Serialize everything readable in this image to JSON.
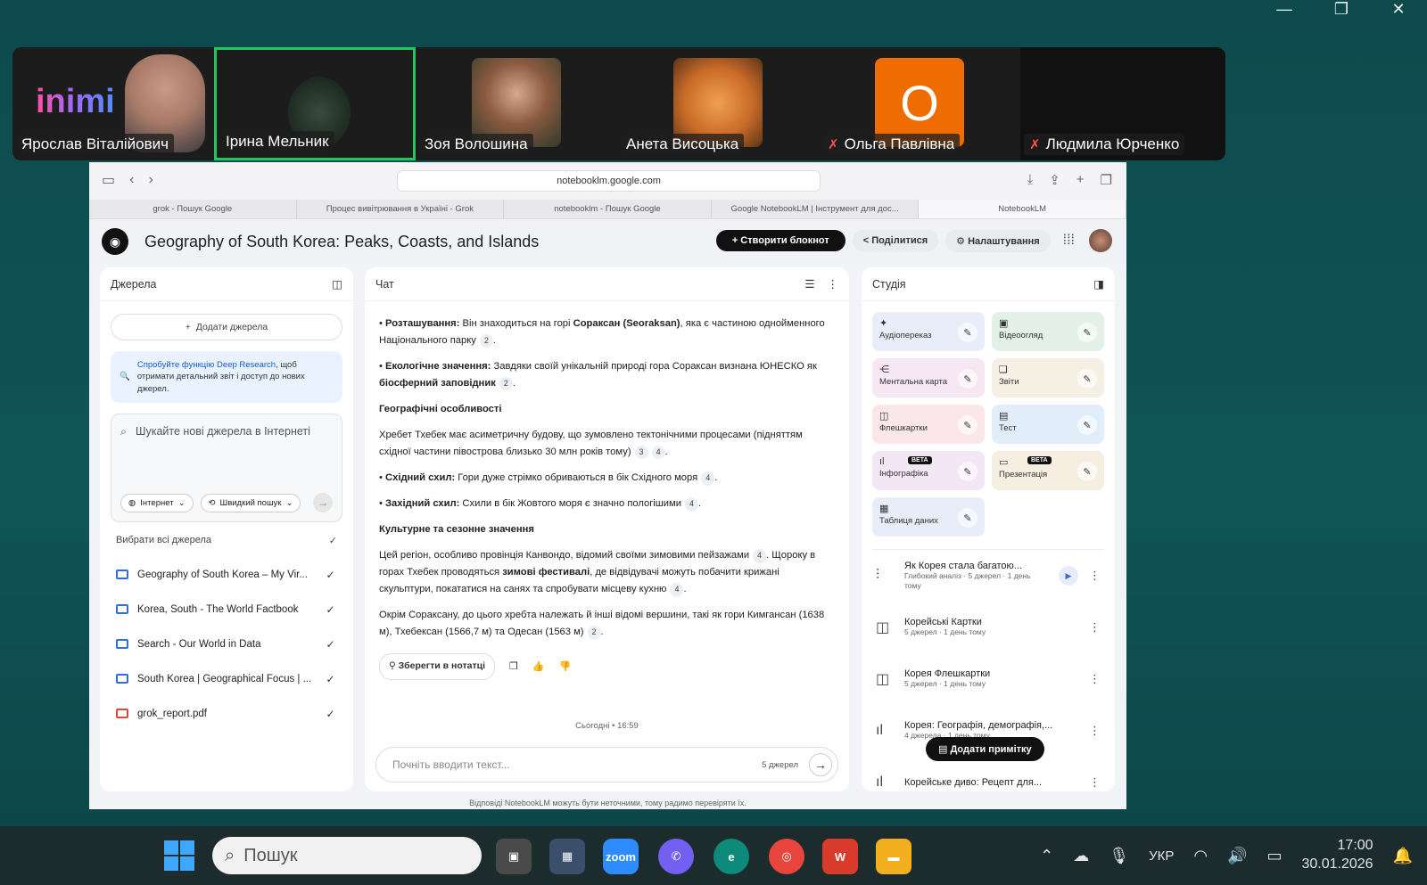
{
  "window": {
    "min": "—",
    "restore": "❐",
    "close": "✕"
  },
  "participants": [
    {
      "name": "Ярослав Віталійович",
      "muted": false
    },
    {
      "name": "Ірина Мельник",
      "muted": false
    },
    {
      "name": "Зоя Волошина",
      "muted": false
    },
    {
      "name": "Анета Висоцька",
      "muted": false
    },
    {
      "name": "Ольга Павлівна",
      "muted": true,
      "initial": "О"
    },
    {
      "name": "Людмила Юрченко",
      "muted": true
    }
  ],
  "browser": {
    "url": "notebooklm.google.com",
    "tabs": [
      "grok - Пошук Google",
      "Процес вивітрювання в Україні - Grok",
      "notebooklm - Пошук Google",
      "Google NotebookLM | Інструмент для дос...",
      "NotebookLM"
    ]
  },
  "notebook": {
    "title": "Geography of South Korea: Peaks, Coasts, and Islands",
    "create": "Створити блокнот",
    "share": "Поділитися",
    "settings": "Налаштування"
  },
  "sources": {
    "title": "Джерела",
    "add": "Додати джерела",
    "deep_link": "Спробуйте функцію Deep Research",
    "deep_rest": ", щоб отримати детальний звіт і доступ до нових джерел.",
    "search_placeholder": "Шукайте нові джерела в Інтернеті",
    "chip_web": "Інтернет",
    "chip_fast": "Швидкий пошук",
    "select_all": "Вибрати всі джерела",
    "items": [
      "Geography of South Korea – My Vir...",
      "Korea, South - The World Factbook",
      "Search - Our World in Data",
      "South Korea | Geographical Focus | ...",
      "grok_report.pdf"
    ]
  },
  "chat": {
    "title": "Чат",
    "p1_b": "Розташування:",
    "p1_a": " Він знаходиться на горі ",
    "p1_b2": "Сораксан (Seoraksan)",
    "p1_c": ", яка є частиною однойменного Національного парку",
    "p1_r": "2",
    "p2_b": "Екологічне значення:",
    "p2_a": " Завдяки своїй унікальній природі гора Сораксан визнана ЮНЕСКО як ",
    "p2_b2": "біосферний заповідник",
    "p2_r": "2",
    "h1": "Географічні особливості",
    "p3": "Хребет Тхебек має асиметричну будову, що зумовлено тектонічними процесами (підняттям східної частини півострова близько 30 млн років тому)",
    "p3_r1": "3",
    "p3_r2": "4",
    "p4_b": "Східний схил:",
    "p4_a": " Гори дуже стрімко обриваються в бік Східного моря",
    "p4_r": "4",
    "p5_b": "Західний схил:",
    "p5_a": " Схили в бік Жовтого моря є значно пологішими",
    "p5_r": "4",
    "h2": "Культурне та сезонне значення",
    "p6_a": "Цей регіон, особливо провінція Канвондо, відомий своїми зимовими пейзажами",
    "p6_r1": "4",
    "p6_b": ". Щороку в горах Тхебек проводяться ",
    "p6_b2": "зимові фестивалі",
    "p6_c": ", де відвідувачі можуть побачити крижані скульптури, покататися на санях та спробувати місцеву кухню",
    "p6_r2": "4",
    "p7": "Окрім Сораксану, до цього хребта належать й інші відомі вершини, такі як гори Кимгансан (1638 м), Тхебексан (1566,7 м) та Одесан (1563 м)",
    "p7_r": "2",
    "save": "Зберегти в нотатці",
    "timestamp": "Сьогодні • 16:59",
    "input_placeholder": "Почніть вводити текст...",
    "count": "5 джерел",
    "disclaimer": "Відповіді NotebookLM можуть бути неточними, тому радимо перевіряти їх."
  },
  "studio": {
    "title": "Студія",
    "cards": [
      {
        "label": "Аудіопереказ",
        "color": "#e7eef9",
        "icon": "✦"
      },
      {
        "label": "Відеоогляд",
        "color": "#e4f1e8",
        "icon": "▣"
      },
      {
        "label": "Ментальна карта",
        "color": "#f6e7f2",
        "icon": "⋲"
      },
      {
        "label": "Звіти",
        "color": "#f5f0e4",
        "icon": "❏"
      },
      {
        "label": "Флешкартки",
        "color": "#fbe7ea",
        "icon": "◫"
      },
      {
        "label": "Тест",
        "color": "#e1eefa",
        "icon": "▤"
      },
      {
        "label": "Інфографіка",
        "color": "#f3e7f5",
        "icon": "ıl",
        "beta": "BETA"
      },
      {
        "label": "Презентація",
        "color": "#f6efe1",
        "icon": "▭",
        "beta": "BETA"
      },
      {
        "label": "Таблиця даних",
        "color": "#e7eef9",
        "icon": "▦"
      }
    ],
    "notes": [
      {
        "t1": "Як Корея стала багатою...",
        "t2": "Глибокий аналіз · 5 джерел · 1 день тому",
        "icon": "audio"
      },
      {
        "t1": "Корейські Картки",
        "t2": "5 джерел · 1 день тому",
        "icon": "cards"
      },
      {
        "t1": "Корея Флешкартки",
        "t2": "5 джерел · 1 день тому",
        "icon": "cards"
      },
      {
        "t1": "Корея: Географія, демографія,...",
        "t2": "4 джерела · 1 день тому",
        "icon": "chart"
      },
      {
        "t1": "Корейське диво: Рецепт для...",
        "t2": "",
        "icon": "chart"
      }
    ],
    "add_note": "Додати примітку"
  },
  "taskbar": {
    "search": "Пошук",
    "lang": "УКР",
    "time": "17:00",
    "date": "30.01.2026"
  }
}
